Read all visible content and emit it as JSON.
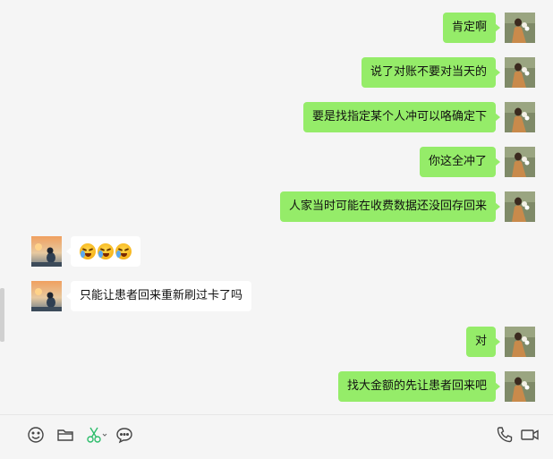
{
  "messages": [
    {
      "side": "right",
      "text": "肯定啊"
    },
    {
      "side": "right",
      "text": "说了对账不要对当天的"
    },
    {
      "side": "right",
      "text": "要是找指定某个人冲可以咯确定下"
    },
    {
      "side": "right",
      "text": "你这全冲了"
    },
    {
      "side": "right",
      "text": "人家当时可能在收费数据还没回存回来"
    },
    {
      "side": "left",
      "type": "emoji",
      "emoji": [
        "sob-emoji",
        "sob-emoji",
        "sob-emoji"
      ]
    },
    {
      "side": "left",
      "text": "只能让患者回来重新刷过卡了吗"
    },
    {
      "side": "right",
      "text": "对"
    },
    {
      "side": "right",
      "text": "找大金额的先让患者回来吧"
    }
  ],
  "toolbar": {
    "left_icons": [
      "emoji-icon",
      "folder-icon",
      "scissors-icon",
      "chat-history-icon"
    ],
    "right_icons": [
      "phone-icon",
      "video-call-icon"
    ]
  },
  "colors": {
    "bubble_self": "#95ec69",
    "bubble_other": "#ffffff",
    "background": "#f5f5f5",
    "scissors": "#2dbd6b"
  }
}
